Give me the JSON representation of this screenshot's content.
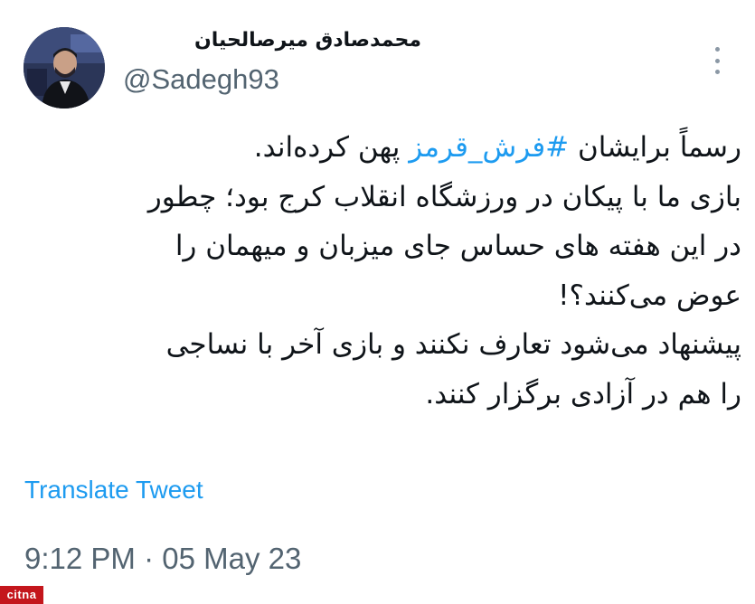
{
  "author": {
    "display_name": "محمدصادق میرصالحیان",
    "handle": "@Sadegh93",
    "avatar_icon": "profile-photo"
  },
  "tweet": {
    "line1_before": "رسماً برایشان ",
    "hashtag": "#فرش_قرمز",
    "line1_after": " پهن کرده‌اند.",
    "line2": "بازی ما با پیکان در ورزشگاه انقلاب کرج بود؛ چطور",
    "line3": "در این هفته های حساس جای میزبان و میهمان را",
    "line4": "عوض می‌کنند؟!",
    "line5": "پیشنهاد می‌شود تعارف نکنند و بازی آخر با نساجی",
    "line6": "را هم در آزادی برگزار کنند."
  },
  "translate_label": "Translate Tweet",
  "timestamp": "9:12 PM · 05 May 23",
  "watermark_text": "citna",
  "more_icon": "more-vertical-icon",
  "colors": {
    "link": "#1d9bf0",
    "secondary_text": "#536471",
    "primary_text": "#0f1419",
    "watermark_bg": "#c4161c"
  }
}
